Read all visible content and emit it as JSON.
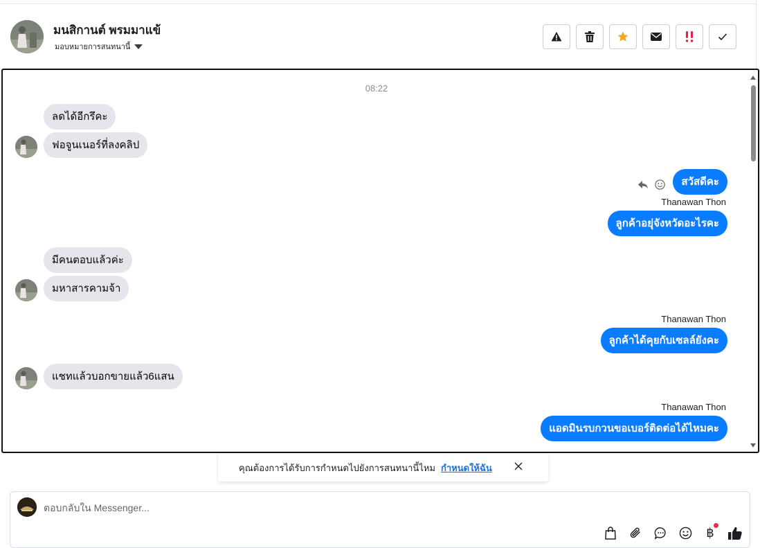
{
  "header": {
    "contact_name": "มนสิกานต์ พรมมาแข้",
    "assign_label": "มอบหมายการสนทนานี้",
    "actions": [
      "warning-icon",
      "trash-icon",
      "star-icon",
      "envelope-icon",
      "important-icon",
      "checkmark-icon"
    ]
  },
  "conversation": {
    "timestamp": "08:22",
    "messages": [
      {
        "dir": "in",
        "text": "ลดได้อีกรึคะ"
      },
      {
        "dir": "in",
        "text": "ฟอจูนเนอร์ที่ลงคลิป"
      },
      {
        "dir": "out",
        "text": "สวัสดีคะ"
      },
      {
        "dir": "out",
        "sender": "Thanawan Thon",
        "text": "ลูกค้าอยุ่จังหวัดอะไรคะ"
      },
      {
        "dir": "in",
        "text": "มีคนตอบแล้วค่ะ"
      },
      {
        "dir": "in",
        "text": "มหาสารคามจ้า"
      },
      {
        "dir": "out",
        "sender": "Thanawan Thon",
        "text": "ลูกค้าได้คุยกับเซลล์ยังคะ"
      },
      {
        "dir": "in",
        "text": "แชทแล้วบอกขายแล้ว6แสน"
      },
      {
        "dir": "out",
        "sender": "Thanawan Thon",
        "text": "แอดมินรบกวนขอเบอร์ติดต่อได้ไหมคะ"
      }
    ]
  },
  "notice": {
    "text": "คุณต้องการได้รับการกำหนดไปยังการสนทนานี้ไหม",
    "link": "กำหนดให้ฉัน"
  },
  "composer": {
    "placeholder": "ตอบกลับใน Messenger...",
    "tools": [
      "bag-icon",
      "paperclip-icon",
      "saved-reply-icon",
      "emoji-icon",
      "baht-icon",
      "like-icon"
    ],
    "baht_symbol": "฿"
  },
  "colors": {
    "outgoing_bubble": "#0a7cff",
    "incoming_bubble": "#e4e6eb",
    "star": "#f5a623",
    "important": "#e41e3f",
    "link": "#1b74e4"
  }
}
